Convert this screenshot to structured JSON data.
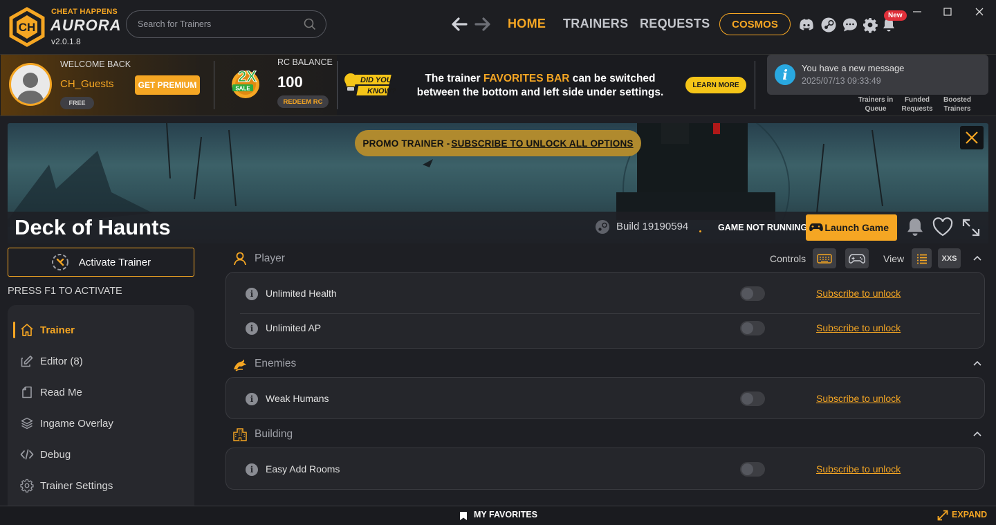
{
  "app": {
    "brand_top": "CHEAT HAPPENS",
    "brand_name": "AURORA",
    "version": "v2.0.1.8"
  },
  "search": {
    "placeholder": "Search for Trainers"
  },
  "nav": {
    "home": "HOME",
    "trainers": "TRAINERS",
    "requests": "REQUESTS",
    "cosmos": "COSMOS",
    "new_badge": "New"
  },
  "user": {
    "welcome": "WELCOME BACK",
    "name": "CH_Guests",
    "tier": "FREE",
    "premium_button": "GET PREMIUM"
  },
  "sale": {
    "badge_big": "2X",
    "badge_small": "SALE"
  },
  "rc": {
    "label": "RC BALANCE",
    "value": "100",
    "redeem": "REDEEM RC"
  },
  "tip": {
    "didyou_1": "DID YOU",
    "didyou_2": "KNOW?",
    "pre": "The trainer ",
    "highlight": "FAVORITES BAR",
    "post": " can be switched between the bottom and left side under settings.",
    "button": "LEARN MORE"
  },
  "notification": {
    "message": "You have a new message",
    "time": "2025/07/13 09:33:49"
  },
  "stats": [
    {
      "label1": "Trainers in",
      "label2": "Queue"
    },
    {
      "label1": "Funded",
      "label2": "Requests"
    },
    {
      "label1": "Boosted",
      "label2": "Trainers"
    }
  ],
  "banner": {
    "promo_prefix": "PROMO TRAINER -",
    "promo_link": "SUBSCRIBE TO UNLOCK ALL OPTIONS"
  },
  "game": {
    "title": "Deck of Haunts",
    "build": "Build 19190594",
    "status": "GAME NOT RUNNING",
    "launch": "Launch Game"
  },
  "sidebar": {
    "activate": "Activate Trainer",
    "hotkey_hint": "PRESS F1 TO ACTIVATE",
    "items": [
      {
        "label": "Trainer",
        "icon": "home-icon"
      },
      {
        "label": "Editor (8)",
        "icon": "edit-icon"
      },
      {
        "label": "Read Me",
        "icon": "document-icon"
      },
      {
        "label": "Ingame Overlay",
        "icon": "layers-icon"
      },
      {
        "label": "Debug",
        "icon": "code-icon"
      },
      {
        "label": "Trainer Settings",
        "icon": "gear-icon"
      }
    ]
  },
  "controls": {
    "controls_label": "Controls",
    "view_label": "View",
    "xxs": "XXS"
  },
  "sections": [
    {
      "title": "Player",
      "icon": "user-icon",
      "options": [
        {
          "name": "Unlimited Health",
          "lock": "Subscribe to unlock"
        },
        {
          "name": "Unlimited AP",
          "lock": "Subscribe to unlock"
        }
      ]
    },
    {
      "title": "Enemies",
      "icon": "dragon-icon",
      "options": [
        {
          "name": "Weak Humans",
          "lock": "Subscribe to unlock"
        }
      ]
    },
    {
      "title": "Building",
      "icon": "building-icon",
      "options": [
        {
          "name": "Easy Add Rooms",
          "lock": "Subscribe to unlock"
        }
      ]
    }
  ],
  "footer": {
    "favorites": "MY FAVORITES",
    "expand": "EXPAND"
  },
  "colors": {
    "accent": "#f5a623",
    "background": "#1e1f24",
    "card": "#25262b"
  }
}
